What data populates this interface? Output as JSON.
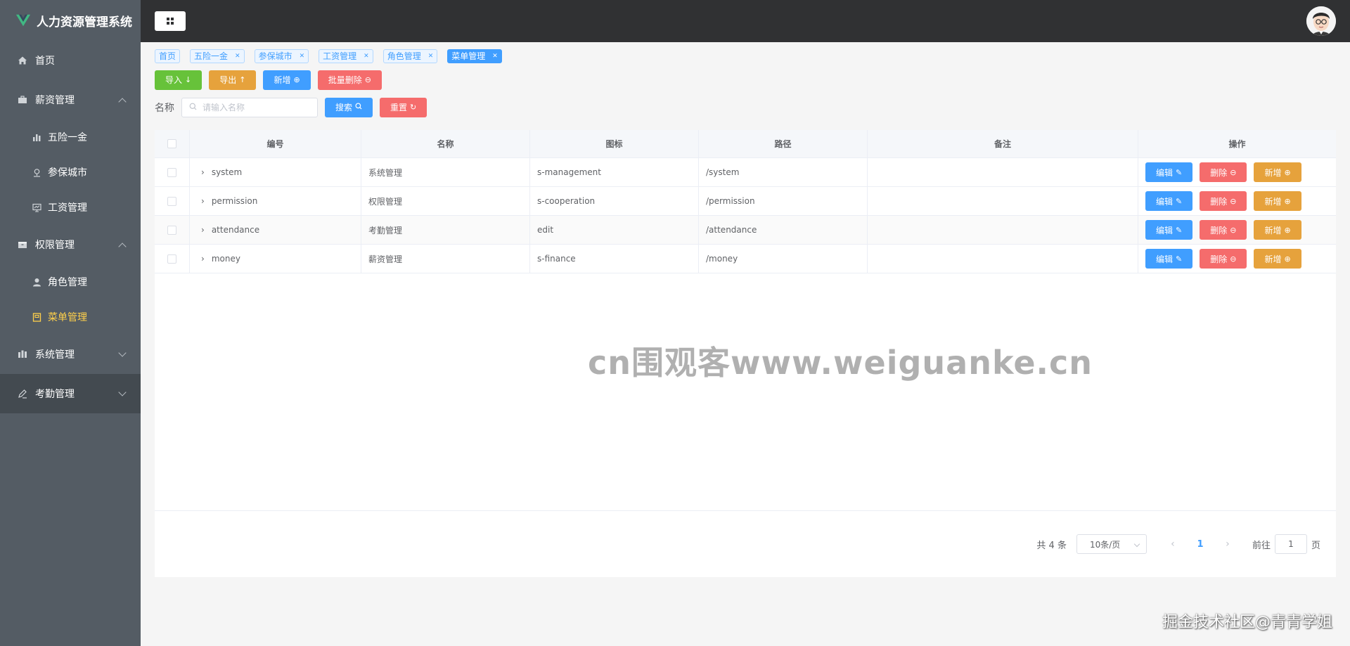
{
  "app": {
    "title": "人力资源管理系统"
  },
  "sidebar": {
    "items": [
      {
        "label": "首页",
        "icon": "home-icon"
      },
      {
        "label": "薪资管理",
        "icon": "briefcase-icon",
        "expanded": true,
        "children": [
          {
            "label": "五险一金",
            "icon": "bar-chart-icon"
          },
          {
            "label": "参保城市",
            "icon": "location-icon"
          },
          {
            "label": "工资管理",
            "icon": "data-board-icon"
          }
        ]
      },
      {
        "label": "权限管理",
        "icon": "box-icon",
        "expanded": true,
        "children": [
          {
            "label": "角色管理",
            "icon": "user-icon"
          },
          {
            "label": "菜单管理",
            "icon": "notebook-icon",
            "active": true
          }
        ]
      },
      {
        "label": "系统管理",
        "icon": "management-icon",
        "expanded": false
      },
      {
        "label": "考勤管理",
        "icon": "edit-icon",
        "expanded": false
      }
    ]
  },
  "tags": [
    {
      "label": "首页",
      "closable": false
    },
    {
      "label": "五险一金",
      "closable": true
    },
    {
      "label": "参保城市",
      "closable": true
    },
    {
      "label": "工资管理",
      "closable": true
    },
    {
      "label": "角色管理",
      "closable": true
    },
    {
      "label": "菜单管理",
      "closable": true,
      "active": true
    }
  ],
  "toolbar": {
    "import_label": "导入",
    "export_label": "导出",
    "add_label": "新增",
    "batch_delete_label": "批量删除"
  },
  "search": {
    "label": "名称",
    "placeholder": "请输入名称",
    "value": "",
    "search_label": "搜索",
    "reset_label": "重置"
  },
  "table": {
    "columns": [
      "编号",
      "名称",
      "图标",
      "路径",
      "备注",
      "操作"
    ],
    "rows": [
      {
        "id": "system",
        "name": "系统管理",
        "icon": "s-management",
        "path": "/system",
        "note": ""
      },
      {
        "id": "permission",
        "name": "权限管理",
        "icon": "s-cooperation",
        "path": "/permission",
        "note": ""
      },
      {
        "id": "attendance",
        "name": "考勤管理",
        "icon": "edit",
        "path": "/attendance",
        "note": ""
      },
      {
        "id": "money",
        "name": "薪资管理",
        "icon": "s-finance",
        "path": "/money",
        "note": ""
      }
    ],
    "row_actions": {
      "edit": "编辑",
      "delete": "删除",
      "add": "新增"
    }
  },
  "pagination": {
    "total_text": "共 4 条",
    "page_size": "10条/页",
    "current_page": "1",
    "goto_prefix": "前往",
    "goto_value": "1",
    "goto_suffix": "页"
  },
  "watermark": "cn围观客www.weiguanke.cn",
  "footer_mark": "掘金技术社区@青青学姐",
  "colors": {
    "sidebar_bg": "#545c64",
    "header_bg": "#303133",
    "active_menu": "#ffd04b",
    "primary": "#409eff",
    "success": "#67c23a",
    "warning": "#e6a23c",
    "danger": "#f56c6c"
  }
}
